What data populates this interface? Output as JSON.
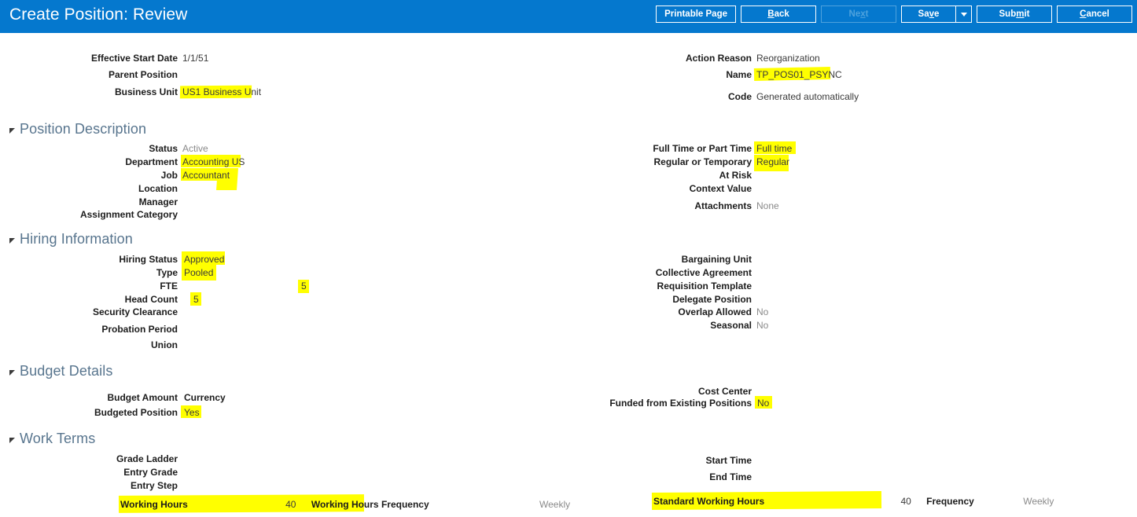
{
  "header": {
    "title": "Create Position: Review",
    "bar_color": "#0578ce",
    "buttons": [
      {
        "id": "printable-page",
        "label": "Printable Page",
        "accesskey": "",
        "state": "enabled"
      },
      {
        "id": "back",
        "label": "Back",
        "accesskey": "B",
        "state": "enabled"
      },
      {
        "id": "next",
        "label": "Next",
        "accesskey": "x",
        "state": "disabled"
      },
      {
        "id": "save",
        "label": "Save",
        "accesskey": "v",
        "state": "enabled",
        "has_dropdown": true
      },
      {
        "id": "submit",
        "label": "Submit",
        "accesskey": "m",
        "state": "enabled"
      },
      {
        "id": "cancel",
        "label": "Cancel",
        "accesskey": "C",
        "state": "enabled"
      }
    ],
    "save_dropdown_icon": "chevron-down-icon"
  },
  "colors": {
    "accent": "#0578ce",
    "section_heading": "#58758e",
    "highlight": "#ffff00",
    "value_text": "#3a3a3a",
    "muted_text": "#8a8a8a"
  },
  "top_fields": {
    "left": [
      {
        "label": "Effective Start Date",
        "value": "1/1/51",
        "highlighted": false
      },
      {
        "label": "Parent Position",
        "value": "",
        "highlighted": false
      },
      {
        "label": "Business Unit",
        "value": "US1 Business Unit",
        "highlighted": true
      }
    ],
    "right": [
      {
        "label": "Action Reason",
        "value": "Reorganization",
        "highlighted": false
      },
      {
        "label": "Name",
        "value": "TP_POS01_PSYNC",
        "highlighted": true
      },
      {
        "label": "Code",
        "value": "Generated automatically",
        "highlighted": false
      }
    ]
  },
  "sections": [
    {
      "id": "position-description",
      "title": "Position Description",
      "collapsed": false,
      "left": [
        {
          "label": "Status",
          "value": "Active",
          "highlighted": false,
          "muted": true
        },
        {
          "label": "Department",
          "value": "Accounting US",
          "highlighted": true
        },
        {
          "label": "Job",
          "value": "Accountant",
          "highlighted": true
        },
        {
          "label": "Location",
          "value": "",
          "highlighted": false
        },
        {
          "label": "Manager",
          "value": "",
          "highlighted": false
        },
        {
          "label": "Assignment Category",
          "value": "",
          "highlighted": false
        }
      ],
      "right": [
        {
          "label": "Full Time or Part Time",
          "value": "Full time",
          "highlighted": true
        },
        {
          "label": "Regular or Temporary",
          "value": "Regular",
          "highlighted": true
        },
        {
          "label": "At Risk",
          "value": "",
          "highlighted": false
        },
        {
          "label": "Context Value",
          "value": "",
          "highlighted": false
        },
        {
          "label": "Attachments",
          "value": "None",
          "highlighted": false,
          "muted": true
        }
      ]
    },
    {
      "id": "hiring-information",
      "title": "Hiring Information",
      "collapsed": false,
      "left": [
        {
          "label": "Hiring Status",
          "value": "Approved",
          "highlighted": true
        },
        {
          "label": "Type",
          "value": "Pooled",
          "highlighted": true
        },
        {
          "label": "FTE",
          "value": "5",
          "highlighted": true
        },
        {
          "label": "Head Count",
          "value": "5",
          "highlighted": true
        },
        {
          "label": "Security Clearance",
          "value": "",
          "highlighted": false
        },
        {
          "label": "Probation Period",
          "value": "",
          "highlighted": false
        },
        {
          "label": "Union",
          "value": "",
          "highlighted": false
        }
      ],
      "right": [
        {
          "label": "Bargaining Unit",
          "value": "",
          "highlighted": false
        },
        {
          "label": "Collective Agreement",
          "value": "",
          "highlighted": false
        },
        {
          "label": "Requisition Template",
          "value": "",
          "highlighted": false
        },
        {
          "label": "Delegate Position",
          "value": "",
          "highlighted": false
        },
        {
          "label": "Overlap Allowed",
          "value": "No",
          "highlighted": false,
          "muted": true
        },
        {
          "label": "Seasonal",
          "value": "No",
          "highlighted": false,
          "muted": true
        }
      ]
    },
    {
      "id": "budget-details",
      "title": "Budget Details",
      "collapsed": false,
      "left": [
        {
          "label": "Budget Amount",
          "value": "",
          "secondary_label": "Currency",
          "highlighted": false
        },
        {
          "label": "Budgeted Position",
          "value": "Yes",
          "highlighted": true
        }
      ],
      "right": [
        {
          "label": "Cost Center",
          "value": "",
          "highlighted": false
        },
        {
          "label": "Funded from Existing Positions",
          "value": "No",
          "highlighted": true
        }
      ]
    },
    {
      "id": "work-terms",
      "title": "Work Terms",
      "collapsed": false,
      "left": [
        {
          "label": "Grade Ladder",
          "value": "",
          "highlighted": false
        },
        {
          "label": "Entry Grade",
          "value": "",
          "highlighted": false
        },
        {
          "label": "Entry Step",
          "value": "",
          "highlighted": false
        }
      ],
      "right": [
        {
          "label": "Start Time",
          "value": "",
          "highlighted": false
        },
        {
          "label": "End Time",
          "value": "",
          "highlighted": false
        }
      ],
      "bottom_left": {
        "label": "Working Hours",
        "value": "40",
        "secondary_label": "Working Hours Frequency",
        "secondary_value": "Weekly",
        "highlighted": true
      },
      "bottom_right": {
        "label": "Standard Working Hours",
        "value": "40",
        "secondary_label": "Frequency",
        "secondary_value": "Weekly",
        "highlighted": true
      }
    }
  ]
}
